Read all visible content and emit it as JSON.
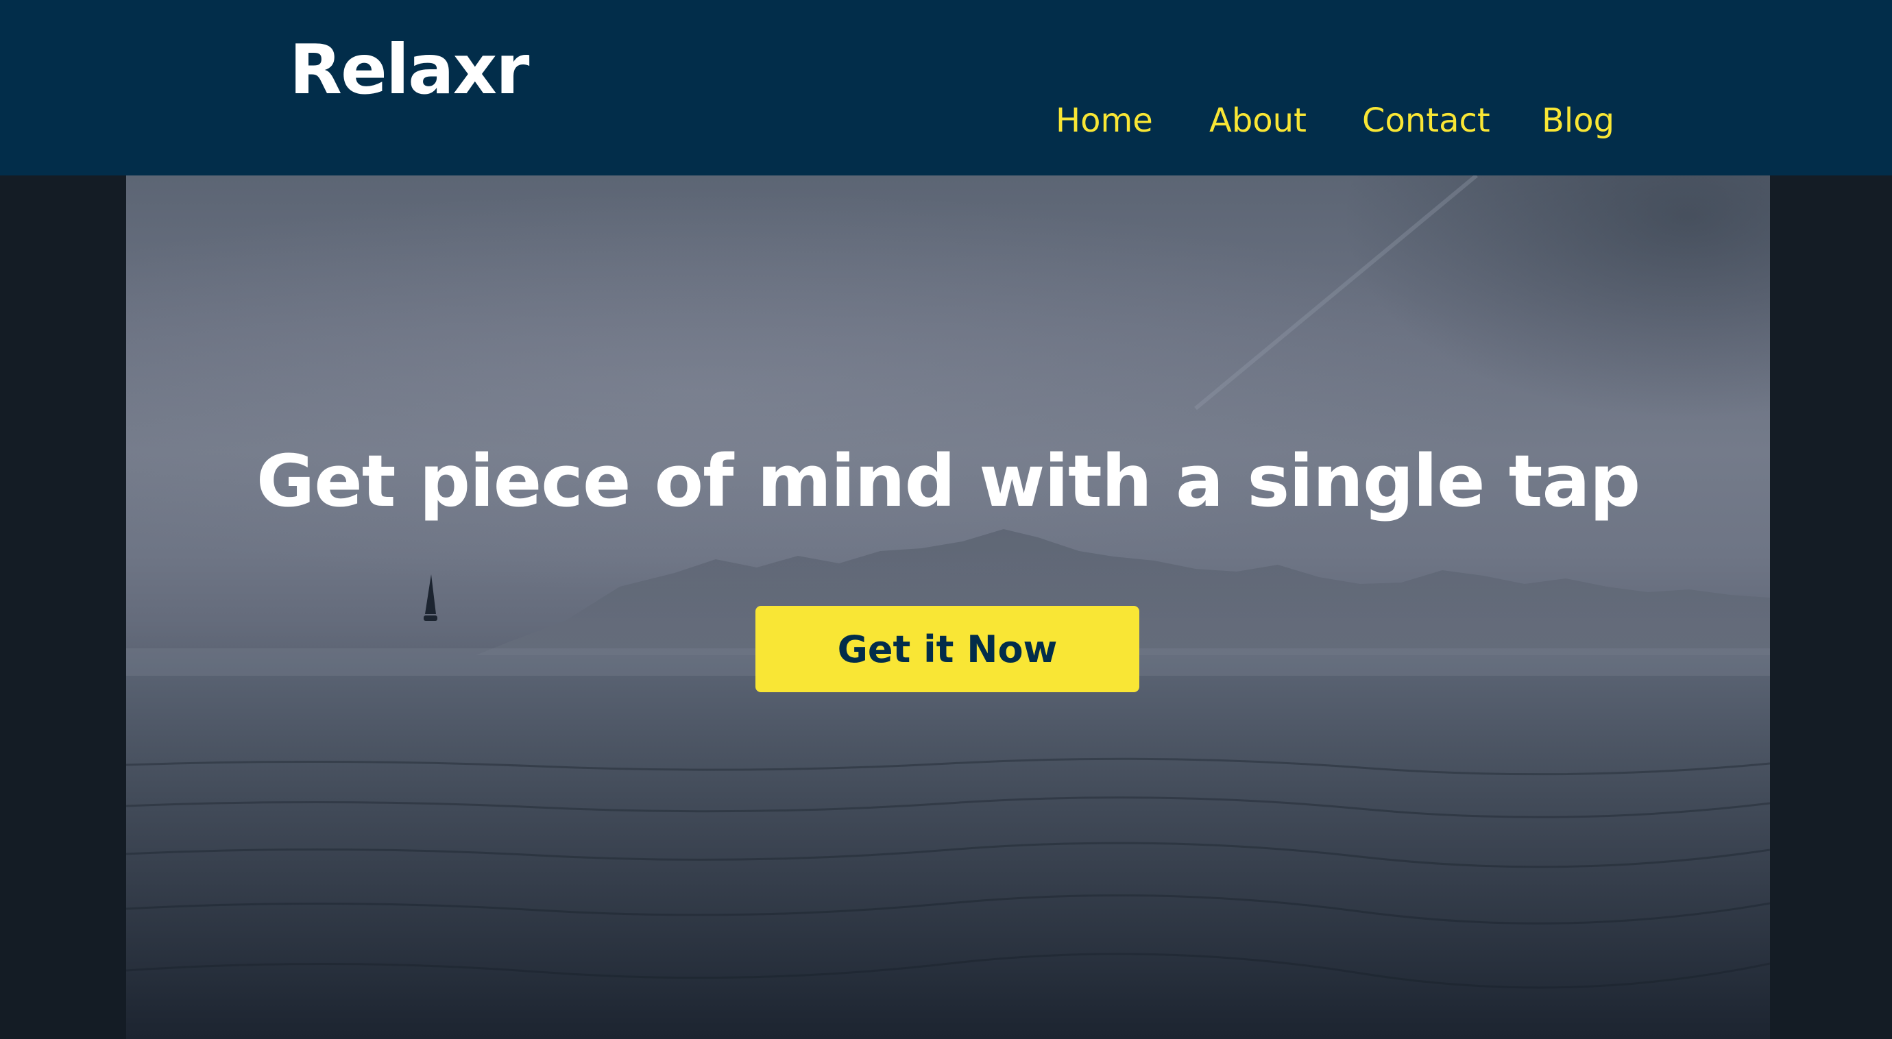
{
  "brand": {
    "name": "Relaxr"
  },
  "nav": {
    "items": [
      {
        "label": "Home"
      },
      {
        "label": "About"
      },
      {
        "label": "Contact"
      },
      {
        "label": "Blog"
      }
    ]
  },
  "hero": {
    "headline": "Get piece of mind with a single tap",
    "cta_label": "Get it Now",
    "image_subject": "misty sea with mountains and sailboat"
  },
  "colors": {
    "header_bg": "#022d4a",
    "page_bg": "#141c25",
    "accent": "#f9e635",
    "headline": "#ffffff",
    "cta_text": "#022d4a"
  }
}
